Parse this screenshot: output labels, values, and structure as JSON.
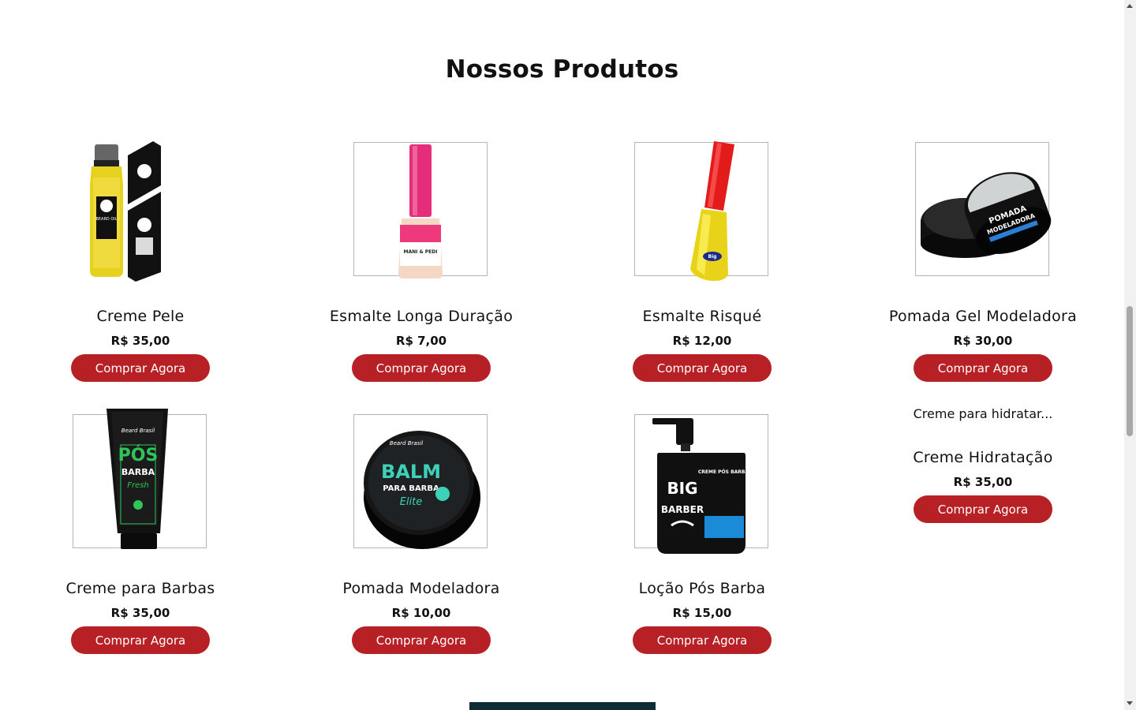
{
  "section": {
    "title": "Nossos Produtos"
  },
  "products": [
    {
      "name": "Creme Pele",
      "price": "R$ 35,00",
      "button": "Comprar Agora",
      "image": "beard-oil-bottle-box",
      "framed": false
    },
    {
      "name": "Esmalte Longa Duração",
      "price": "R$ 7,00",
      "button": "Comprar Agora",
      "image": "pink-nail-polish",
      "framed": true
    },
    {
      "name": "Esmalte Risqué",
      "price": "R$ 12,00",
      "button": "Comprar Agora",
      "image": "yellow-nail-polish",
      "framed": true
    },
    {
      "name": "Pomada Gel Modeladora",
      "price": "R$ 30,00",
      "button": "Comprar Agora",
      "image": "pomade-jars",
      "framed": true
    },
    {
      "name": "Creme para Barbas",
      "price": "R$ 35,00",
      "button": "Comprar Agora",
      "image": "pos-barba-tube",
      "framed": true
    },
    {
      "name": "Pomada Modeladora",
      "price": "R$ 10,00",
      "button": "Comprar Agora",
      "image": "balm-para-barba-tin",
      "framed": true
    },
    {
      "name": "Loção Pós Barba",
      "price": "R$ 15,00",
      "button": "Comprar Agora",
      "image": "big-barber-pump",
      "framed": true
    },
    {
      "name": "Creme Hidratação",
      "price": "R$ 35,00",
      "button": "Comprar Agora",
      "image": "broken-image",
      "framed": false,
      "alt_text": "Creme para hidratar..."
    }
  ],
  "image_labels": {
    "beard_oil": "BEARD OIL",
    "mani_pedi": "MANI & PEDI",
    "big": "Big",
    "pomada": "POMADA",
    "modeladora": "MODELADORA",
    "beard_brasil": "Beard Brasil",
    "pos": "PÓS",
    "barba": "BARBA",
    "fresh": "Fresh",
    "balm": "BALM",
    "para_barba": "PARA BARBA",
    "elite": "Elite",
    "big_barber_1": "BIG",
    "big_barber_2": "BARBER",
    "creme_pos_barba": "CREME PÓS BARBA"
  },
  "colors": {
    "button": "#b72025",
    "frame": "#b5b5b5",
    "footer": "#0f2d36"
  }
}
